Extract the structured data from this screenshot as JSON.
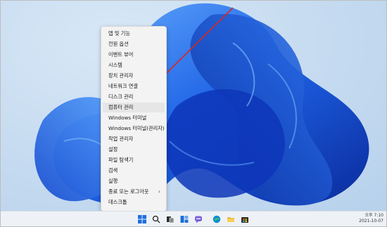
{
  "context_menu": {
    "items": [
      {
        "label": "앱 및 기능"
      },
      {
        "label": "전원 옵션"
      },
      {
        "label": "이벤트 뷰어"
      },
      {
        "label": "시스템"
      },
      {
        "label": "장치 관리자"
      },
      {
        "label": "네트워크 연결"
      },
      {
        "label": "디스크 관리"
      },
      {
        "label": "컴퓨터 관리",
        "highlighted": true
      },
      {
        "label": "Windows 터미널"
      },
      {
        "label": "Windows 터미널(관리자)"
      },
      {
        "label": "작업 관리자"
      },
      {
        "label": "설정"
      },
      {
        "label": "파일 탐색기"
      },
      {
        "label": "검색"
      },
      {
        "label": "실행"
      },
      {
        "label": "종료 또는 로그아웃",
        "submenu": true
      },
      {
        "label": "데스크톱"
      }
    ],
    "submenu_glyph": "›"
  },
  "taskbar": {
    "icons": [
      "windows-start-icon",
      "search-icon",
      "task-view-icon",
      "widgets-icon",
      "chat-icon",
      "edge-icon",
      "file-explorer-icon",
      "store-icon"
    ],
    "clock": {
      "time": "오후 7:10",
      "date": "2021-10-07"
    }
  },
  "colors": {
    "annotation_arrow": "#d9271f",
    "bloom_dark": "#0a2fa8",
    "bloom_light": "#3d8bf0",
    "menu_bg": "#f3f3f3",
    "highlight_bg": "#e6e6e6"
  }
}
